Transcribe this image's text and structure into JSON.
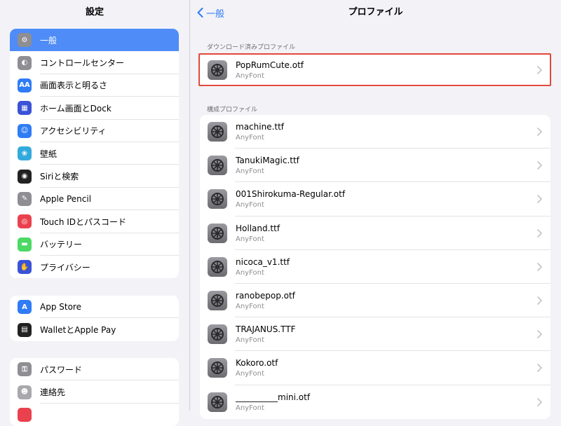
{
  "sidebar": {
    "title": "設定",
    "group1": [
      {
        "label": "一般",
        "icon": "gear-icon",
        "color": "#8e8e93",
        "glyph": "⚙"
      },
      {
        "label": "コントロールセンター",
        "icon": "control-center-icon",
        "color": "#8e8e93",
        "glyph": "◐"
      },
      {
        "label": "画面表示と明るさ",
        "icon": "display-brightness-icon",
        "color": "#2f7cf6",
        "glyph": "AA"
      },
      {
        "label": "ホーム画面とDock",
        "icon": "home-screen-icon",
        "color": "#3a53d6",
        "glyph": "▦"
      },
      {
        "label": "アクセシビリティ",
        "icon": "accessibility-icon",
        "color": "#2f7cf6",
        "glyph": "☺"
      },
      {
        "label": "壁紙",
        "icon": "wallpaper-icon",
        "color": "#34aadc",
        "glyph": "❀"
      },
      {
        "label": "Siriと検索",
        "icon": "siri-icon",
        "color": "#222222",
        "glyph": "◉"
      },
      {
        "label": "Apple Pencil",
        "icon": "pencil-icon",
        "color": "#8e8e93",
        "glyph": "✎"
      },
      {
        "label": "Touch IDとパスコード",
        "icon": "fingerprint-icon",
        "color": "#e9414d",
        "glyph": "◎"
      },
      {
        "label": "バッテリー",
        "icon": "battery-icon",
        "color": "#4cd964",
        "glyph": "▬"
      },
      {
        "label": "プライバシー",
        "icon": "hand-icon",
        "color": "#3a53d6",
        "glyph": "✋"
      }
    ],
    "group2": [
      {
        "label": "App Store",
        "icon": "app-store-icon",
        "color": "#2f7cf6",
        "glyph": "A"
      },
      {
        "label": "WalletとApple Pay",
        "icon": "wallet-icon",
        "color": "#222222",
        "glyph": "▤"
      }
    ],
    "group3": [
      {
        "label": "パスワード",
        "icon": "key-icon",
        "color": "#8e8e93",
        "glyph": "⚿"
      },
      {
        "label": "連絡先",
        "icon": "contacts-icon",
        "color": "#a8a8ad",
        "glyph": "☻"
      },
      {
        "label": "",
        "icon": "calendar-icon",
        "color": "#e9414d",
        "glyph": ""
      }
    ]
  },
  "detail": {
    "back_label": "一般",
    "title": "プロファイル",
    "downloaded_header": "ダウンロード済みプロファイル",
    "downloaded": [
      {
        "name": "PopRumCute.otf",
        "sub": "AnyFont"
      }
    ],
    "config_header": "構成プロファイル",
    "configs": [
      {
        "name": "machine.ttf",
        "sub": "AnyFont"
      },
      {
        "name": "TanukiMagic.ttf",
        "sub": "AnyFont"
      },
      {
        "name": "001Shirokuma-Regular.otf",
        "sub": "AnyFont"
      },
      {
        "name": "Holland.ttf",
        "sub": "AnyFont"
      },
      {
        "name": "nicoca_v1.ttf",
        "sub": "AnyFont"
      },
      {
        "name": "ranobepop.otf",
        "sub": "AnyFont"
      },
      {
        "name": "TRAJANUS.TTF",
        "sub": "AnyFont"
      },
      {
        "name": "Kokoro.otf",
        "sub": "AnyFont"
      },
      {
        "name": "__________mini.otf",
        "sub": "AnyFont"
      }
    ]
  },
  "colors": {
    "accent": "#2f7cf6",
    "selected": "#4f8cf7",
    "highlight": "#e2473b"
  }
}
